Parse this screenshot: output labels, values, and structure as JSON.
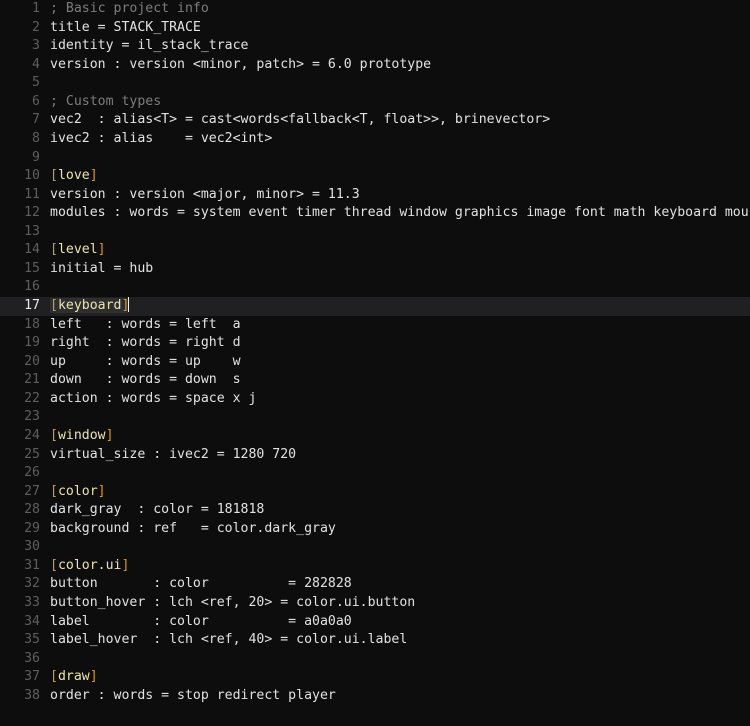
{
  "editor": {
    "name": "code-editor",
    "language": "ini",
    "background_color": "#0d0d0d",
    "active_line_color": "#202022",
    "selection_color": "#2e2e2e",
    "text_color": "#e2e2e2",
    "comment_color": "#7c7c7c",
    "bracket_color": "#d99a1f",
    "section_color": "#ece3b0",
    "gutter_color": "#5e5e5e",
    "gutter_active_color": "#e6e6e6",
    "cursor_line": 17,
    "cursor_column": 11,
    "total_lines": 38
  },
  "lines": [
    {
      "n": "1",
      "type": "comment",
      "text": "; Basic project info"
    },
    {
      "n": "2",
      "type": "plain",
      "text": "title = STACK_TRACE"
    },
    {
      "n": "3",
      "type": "plain",
      "text": "identity = il_stack_trace"
    },
    {
      "n": "4",
      "type": "plain",
      "text": "version : version <minor, patch> = 6.0 prototype"
    },
    {
      "n": "5",
      "type": "blank",
      "text": ""
    },
    {
      "n": "6",
      "type": "comment",
      "text": "; Custom types"
    },
    {
      "n": "7",
      "type": "plain",
      "text": "vec2  : alias<T> = cast<words<fallback<T, float>>, brinevector>"
    },
    {
      "n": "8",
      "type": "plain",
      "text": "ivec2 : alias    = vec2<int>"
    },
    {
      "n": "9",
      "type": "blank",
      "text": ""
    },
    {
      "n": "10",
      "type": "section",
      "text": "[love]",
      "section_name": "love"
    },
    {
      "n": "11",
      "type": "plain",
      "text": "version : version <major, minor> = 11.3"
    },
    {
      "n": "12",
      "type": "plain",
      "text": "modules : words = system event timer thread window graphics image font math keyboard mouse"
    },
    {
      "n": "13",
      "type": "blank",
      "text": ""
    },
    {
      "n": "14",
      "type": "section",
      "text": "[level]",
      "section_name": "level"
    },
    {
      "n": "15",
      "type": "plain",
      "text": "initial = hub"
    },
    {
      "n": "16",
      "type": "blank",
      "text": ""
    },
    {
      "n": "17",
      "type": "section",
      "text": "[keyboard]",
      "section_name": "keyboard",
      "active": true,
      "selected": true
    },
    {
      "n": "18",
      "type": "plain",
      "text": "left   : words = left  a"
    },
    {
      "n": "19",
      "type": "plain",
      "text": "right  : words = right d"
    },
    {
      "n": "20",
      "type": "plain",
      "text": "up     : words = up    w"
    },
    {
      "n": "21",
      "type": "plain",
      "text": "down   : words = down  s"
    },
    {
      "n": "22",
      "type": "plain",
      "text": "action : words = space x j"
    },
    {
      "n": "23",
      "type": "blank",
      "text": ""
    },
    {
      "n": "24",
      "type": "section",
      "text": "[window]",
      "section_name": "window"
    },
    {
      "n": "25",
      "type": "plain",
      "text": "virtual_size : ivec2 = 1280 720"
    },
    {
      "n": "26",
      "type": "blank",
      "text": ""
    },
    {
      "n": "27",
      "type": "section",
      "text": "[color]",
      "section_name": "color"
    },
    {
      "n": "28",
      "type": "plain",
      "text": "dark_gray  : color = 181818"
    },
    {
      "n": "29",
      "type": "plain",
      "text": "background : ref   = color.dark_gray"
    },
    {
      "n": "30",
      "type": "blank",
      "text": ""
    },
    {
      "n": "31",
      "type": "section",
      "text": "[color.ui]",
      "section_name": "color.ui"
    },
    {
      "n": "32",
      "type": "plain",
      "text": "button       : color          = 282828"
    },
    {
      "n": "33",
      "type": "plain",
      "text": "button_hover : lch <ref, 20> = color.ui.button"
    },
    {
      "n": "34",
      "type": "plain",
      "text": "label        : color          = a0a0a0"
    },
    {
      "n": "35",
      "type": "plain",
      "text": "label_hover  : lch <ref, 40> = color.ui.label"
    },
    {
      "n": "36",
      "type": "blank",
      "text": ""
    },
    {
      "n": "37",
      "type": "section",
      "text": "[draw]",
      "section_name": "draw"
    },
    {
      "n": "38",
      "type": "plain",
      "text": "order : words = stop redirect player"
    }
  ]
}
